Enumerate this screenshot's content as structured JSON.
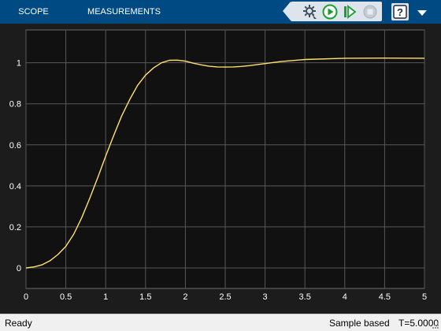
{
  "tabs": [
    {
      "label": "SCOPE"
    },
    {
      "label": "MEASUREMENTS"
    }
  ],
  "toolbar": {
    "icons": [
      "settings-icon",
      "run-icon",
      "step-forward-icon",
      "stop-icon",
      "help-icon",
      "menu-icon"
    ],
    "help_label": "?"
  },
  "colors": {
    "header": "#004a83",
    "plot_background": "#111111",
    "grid": "#585858",
    "tick_label": "#ffffff",
    "signal": "#ffe16c",
    "run_green": "#1b9e2f",
    "status_bar": "#f0f0f0"
  },
  "status": {
    "ready": "Ready",
    "mode": "Sample based",
    "time": "T=5.0000"
  },
  "chart_data": {
    "type": "line",
    "title": "",
    "xlabel": "",
    "ylabel": "",
    "xlim": [
      0,
      5
    ],
    "ylim": [
      -0.1,
      1.16
    ],
    "xticks": [
      "0",
      "0.5",
      "1",
      "1.5",
      "2",
      "2.5",
      "3",
      "3.5",
      "4",
      "4.5",
      "5"
    ],
    "yticks": [
      "0",
      "0.2",
      "0.4",
      "0.6",
      "0.8",
      "1"
    ],
    "grid": true,
    "series": [
      {
        "x": [
          0,
          0.1,
          0.2,
          0.3,
          0.4,
          0.5,
          0.6,
          0.7,
          0.8,
          0.9,
          1.0,
          1.1,
          1.2,
          1.3,
          1.4,
          1.5,
          1.6,
          1.7,
          1.8,
          1.9,
          2.0,
          2.1,
          2.2,
          2.3,
          2.4,
          2.5,
          2.6,
          2.7,
          2.8,
          3.0,
          3.2,
          3.5,
          4.0,
          4.5,
          5.0
        ],
        "y": [
          0,
          0.005,
          0.015,
          0.035,
          0.065,
          0.105,
          0.165,
          0.245,
          0.34,
          0.44,
          0.545,
          0.645,
          0.74,
          0.82,
          0.89,
          0.94,
          0.975,
          1.0,
          1.012,
          1.013,
          1.008,
          0.998,
          0.99,
          0.983,
          0.98,
          0.979,
          0.98,
          0.982,
          0.986,
          0.996,
          1.006,
          1.016,
          1.022,
          1.023,
          1.022
        ]
      }
    ]
  }
}
